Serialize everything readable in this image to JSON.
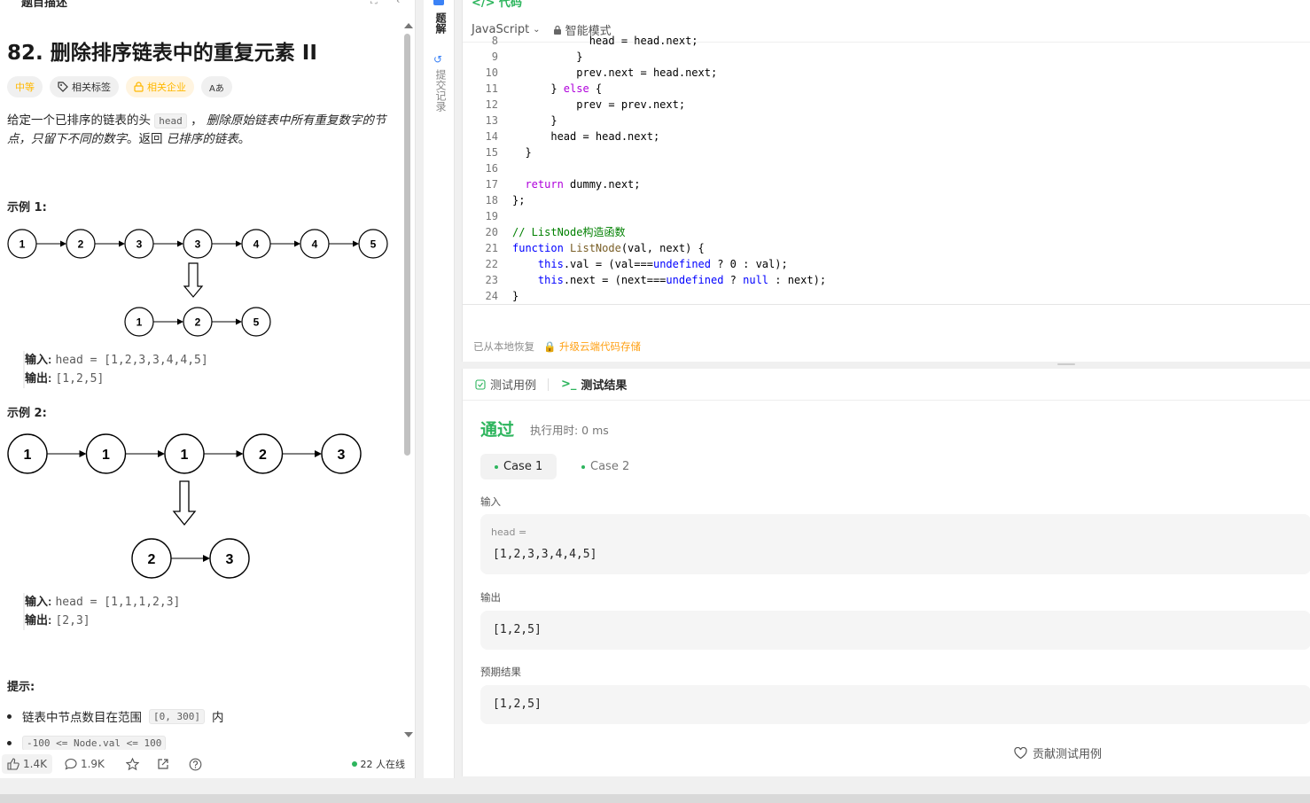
{
  "left_panel": {
    "tab_title": "题目描述",
    "title": "82. 删除排序链表中的重复元素 II",
    "tags": {
      "difficulty": "中等",
      "topics": "相关标签",
      "companies": "相关企业",
      "translate": "Aあ"
    },
    "description": {
      "p1": "给定一个已排序的链表的头",
      "code_head": "head",
      "p2": "，",
      "p3": "删除原始链表中所有重复数字的节点，只留下不同的数字",
      "p4": "。返回",
      "p5": "已排序的链表",
      "p6": "。"
    },
    "example1": {
      "title": "示例 1:",
      "top_nodes": [
        "1",
        "2",
        "3",
        "3",
        "4",
        "4",
        "5"
      ],
      "bottom_nodes": [
        "1",
        "2",
        "5"
      ],
      "input_label": "输入:",
      "input_value": "head = [1,2,3,3,4,4,5]",
      "output_label": "输出:",
      "output_value": "[1,2,5]"
    },
    "example2": {
      "title": "示例 2:",
      "top_nodes": [
        "1",
        "1",
        "1",
        "2",
        "3"
      ],
      "bottom_nodes": [
        "2",
        "3"
      ],
      "input_label": "输入:",
      "input_value": "head = [1,1,1,2,3]",
      "output_label": "输出:",
      "output_value": "[2,3]"
    },
    "hints": {
      "title": "提示:",
      "item1_a": "链表中节点数目在范围",
      "item1_code": "[0, 300]",
      "item1_b": "内",
      "item2": "-100 <= Node.val <= 100"
    },
    "footer": {
      "likes": "1.4K",
      "comments": "1.9K",
      "online": "22 人在线"
    }
  },
  "side_tabs": {
    "solutions": "题解",
    "submissions": "提交记录"
  },
  "code_panel": {
    "title": "</> 代码",
    "language": "JavaScript",
    "mode": "智能模式",
    "lines": [
      {
        "n": "8",
        "t": "            head = head.next;"
      },
      {
        "n": "9",
        "t": "          }"
      },
      {
        "n": "10",
        "t": "          prev.next = head.next;"
      },
      {
        "n": "11",
        "t": "      } else {"
      },
      {
        "n": "12",
        "t": "          prev = prev.next;"
      },
      {
        "n": "13",
        "t": "      }"
      },
      {
        "n": "14",
        "t": "      head = head.next;"
      },
      {
        "n": "15",
        "t": "  }"
      },
      {
        "n": "16",
        "t": ""
      },
      {
        "n": "17",
        "t": "  return dummy.next;"
      },
      {
        "n": "18",
        "t": "};"
      },
      {
        "n": "19",
        "t": ""
      },
      {
        "n": "20",
        "t": "// ListNode构造函数"
      },
      {
        "n": "21",
        "t": "function ListNode(val, next) {"
      },
      {
        "n": "22",
        "t": "    this.val = (val===undefined ? 0 : val);"
      },
      {
        "n": "23",
        "t": "    this.next = (next===undefined ? null : next);"
      },
      {
        "n": "24",
        "t": "}"
      }
    ],
    "status_left": "已从本地恢复",
    "status_upgrade": "升级云端代码存储"
  },
  "result_panel": {
    "tab_testcase": "测试用例",
    "tab_result": "测试结果",
    "status": "通过",
    "runtime": "执行用时: 0 ms",
    "case1": "Case 1",
    "case2": "Case 2",
    "input_label": "输入",
    "input_var": "head =",
    "input_value": "[1,2,3,3,4,4,5]",
    "output_label": "输出",
    "output_value": "[1,2,5]",
    "expected_label": "预期结果",
    "expected_value": "[1,2,5]",
    "contribute": "贡献测试用例"
  },
  "colors": {
    "accent_green": "#2db55d",
    "accent_orange": "#ffa116",
    "difficulty": "#ffb800"
  }
}
